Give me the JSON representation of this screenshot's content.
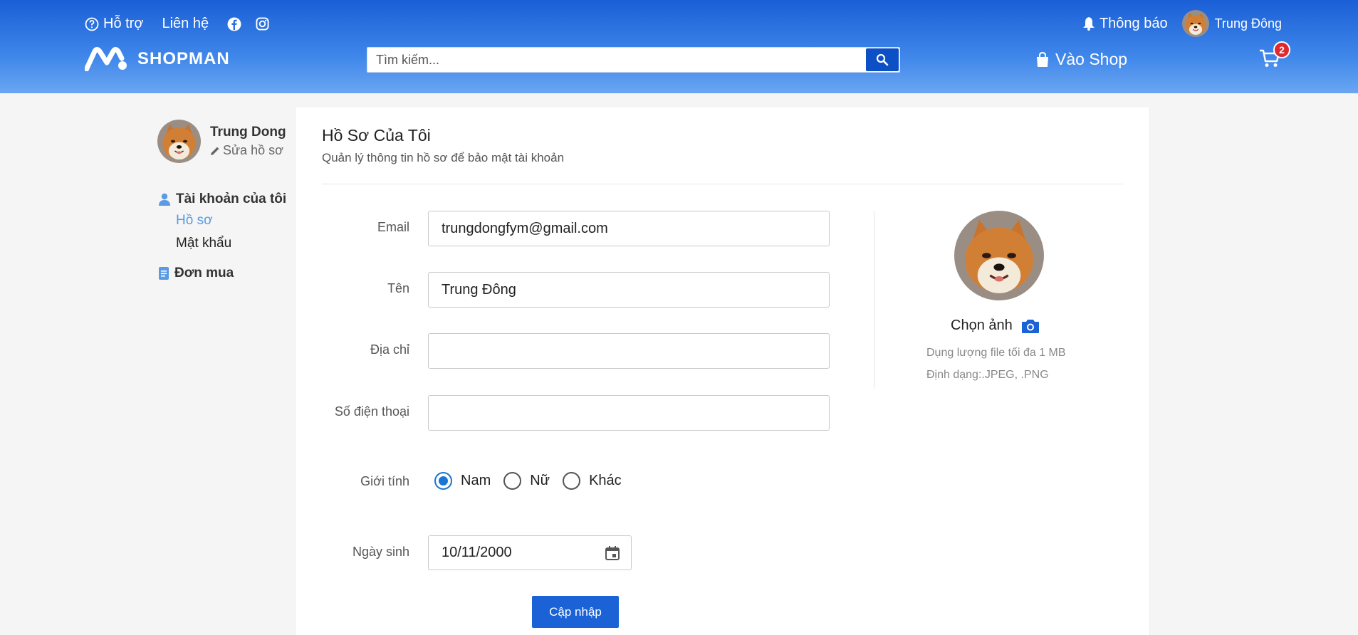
{
  "header": {
    "support_label": "Hỗ trợ",
    "contact_label": "Liên hệ",
    "notification_label": "Thông báo",
    "user_name": "Trung Đông",
    "brand": "SHOPMAN",
    "search_placeholder": "Tìm kiếm...",
    "shop_label": "Vào Shop",
    "cart_count": "2",
    "accent": "#1a5fd6"
  },
  "sidebar": {
    "name": "Trung Dong",
    "edit_label": "Sửa hồ sơ",
    "account_label": "Tài khoản của tôi",
    "profile_label": "Hồ sơ",
    "password_label": "Mật khẩu",
    "orders_label": "Đơn mua"
  },
  "profile": {
    "title": "Hồ Sơ Của Tôi",
    "subtitle": "Quản lý thông tin hồ sơ để bảo mật tài khoản",
    "email_label": "Email",
    "email_value": "trungdongfym@gmail.com",
    "name_label": "Tên",
    "name_value": "Trung Đông",
    "address_label": "Địa chỉ",
    "address_value": "",
    "phone_label": "Số điện thoại",
    "phone_value": "",
    "gender_label": "Giới tính",
    "gender_options": [
      "Nam",
      "Nữ",
      "Khác"
    ],
    "gender_selected": "Nam",
    "birthday_label": "Ngày sinh",
    "birthday_value": "10/11/2000",
    "save_label": "Cập nhập"
  },
  "avatar_panel": {
    "choose_label": "Chọn ảnh",
    "size_note": "Dụng lượng file tối đa 1 MB",
    "format_note": "Định dạng:.JPEG, .PNG"
  }
}
